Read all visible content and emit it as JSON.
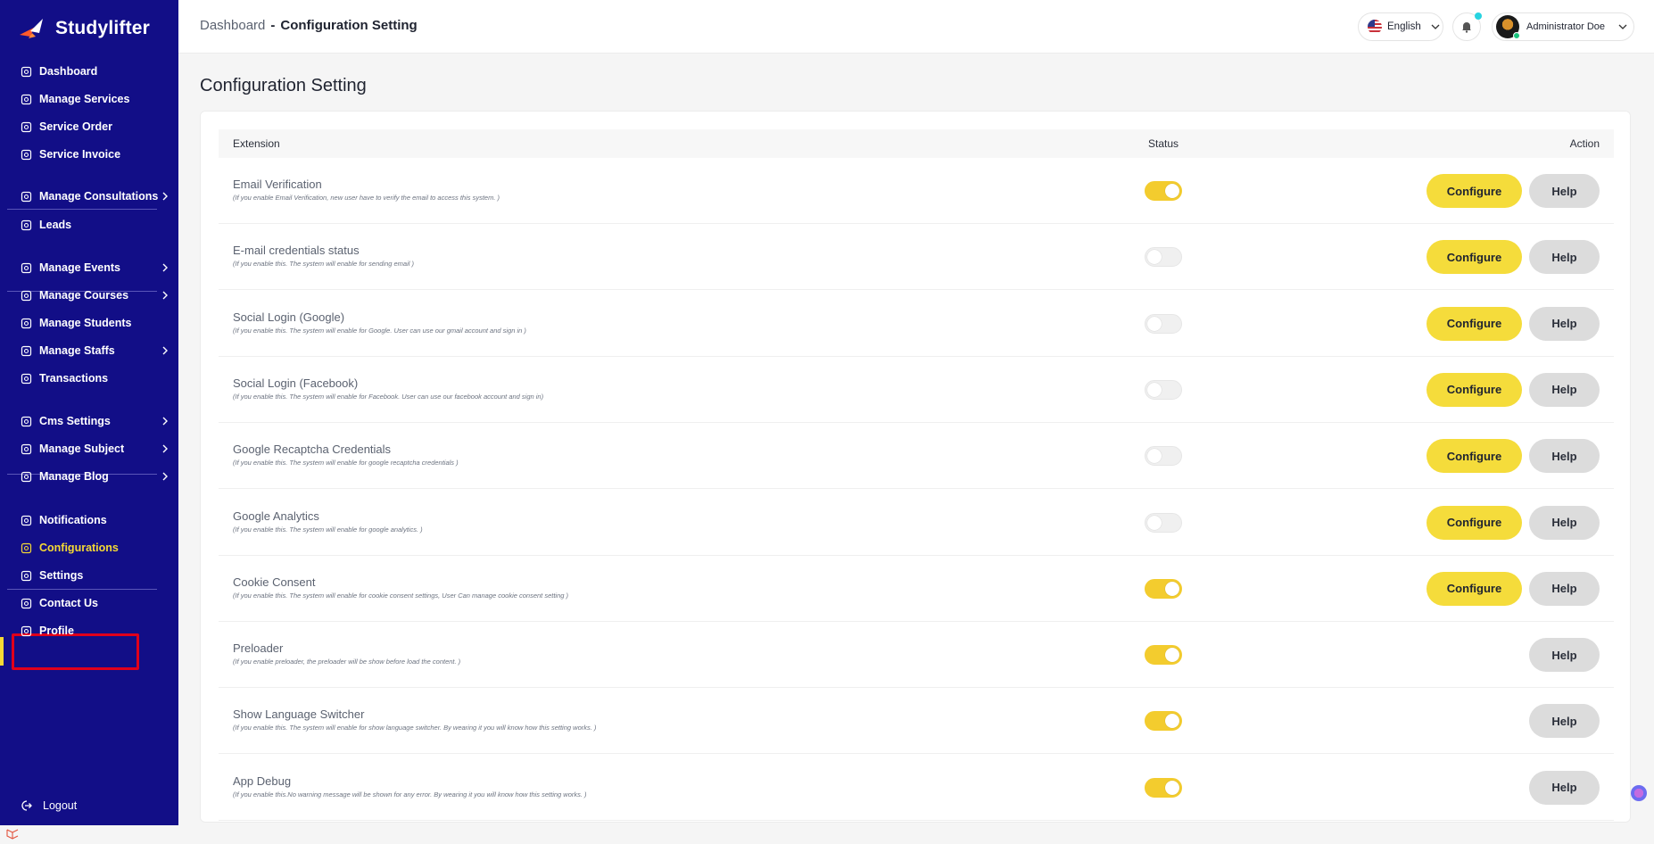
{
  "brand": {
    "name": "Studylifter"
  },
  "sidebar": {
    "items": [
      {
        "label": "Dashboard",
        "icon": "grid-icon"
      },
      {
        "label": "Manage Services",
        "icon": "services-icon"
      },
      {
        "label": "Service Order",
        "icon": "list-icon"
      },
      {
        "label": "Service Invoice",
        "icon": "invoice-icon"
      },
      {
        "label": "Manage Consultations",
        "icon": "consultation-icon",
        "expandable": true
      },
      {
        "label": "Leads",
        "icon": "dollar-icon"
      },
      {
        "label": "Manage Events",
        "icon": "calendar-icon",
        "expandable": true
      },
      {
        "label": "Manage Courses",
        "icon": "course-icon",
        "expandable": true
      },
      {
        "label": "Manage Students",
        "icon": "students-icon"
      },
      {
        "label": "Manage Staffs",
        "icon": "staff-icon",
        "expandable": true
      },
      {
        "label": "Transactions",
        "icon": "transaction-icon"
      },
      {
        "label": "Cms Settings",
        "icon": "gear-icon",
        "expandable": true
      },
      {
        "label": "Manage Subject",
        "icon": "book-icon",
        "expandable": true
      },
      {
        "label": "Manage Blog",
        "icon": "blog-icon",
        "expandable": true
      },
      {
        "label": "Notifications",
        "icon": "bell-icon"
      },
      {
        "label": "Configurations",
        "icon": "config-icon",
        "active": true
      },
      {
        "label": "Settings",
        "icon": "settings-icon"
      },
      {
        "label": "Contact Us",
        "icon": "contact-icon"
      },
      {
        "label": "Profile",
        "icon": "user-icon"
      }
    ],
    "logout": "Logout"
  },
  "header": {
    "breadcrumb_home": "Dashboard",
    "breadcrumb_sep": "-",
    "breadcrumb_current": "Configuration Setting",
    "language": "English",
    "user_name": "Administrator Doe"
  },
  "page": {
    "title": "Configuration Setting"
  },
  "table": {
    "headers": {
      "extension": "Extension",
      "status": "Status",
      "action": "Action"
    },
    "configure_label": "Configure",
    "help_label": "Help",
    "rows": [
      {
        "title": "Email Verification",
        "desc": "(If you enable Email Verification, new user have to verify the email to access this system. )",
        "enabled": true,
        "configurable": true
      },
      {
        "title": "E-mail credentials status",
        "desc": "(If you enable this. The system will enable for sending email )",
        "enabled": false,
        "configurable": true
      },
      {
        "title": "Social Login (Google)",
        "desc": "(If you enable this. The system will enable for Google. User can use our gmail account and sign in )",
        "enabled": false,
        "configurable": true
      },
      {
        "title": "Social Login (Facebook)",
        "desc": "(If you enable this. The system will enable for Facebook. User can use our facebook account and sign in)",
        "enabled": false,
        "configurable": true
      },
      {
        "title": "Google Recaptcha Credentials",
        "desc": "(If you enable this. The system will enable for google recaptcha credentials )",
        "enabled": false,
        "configurable": true
      },
      {
        "title": "Google Analytics",
        "desc": "(If you enable this. The system will enable for google analytics. )",
        "enabled": false,
        "configurable": true
      },
      {
        "title": "Cookie Consent",
        "desc": "(If you enable this. The system will enable for cookie consent settings, User Can manage cookie consent setting )",
        "enabled": true,
        "configurable": true
      },
      {
        "title": "Preloader",
        "desc": "(If you enable preloader, the preloader will be show before load the content. )",
        "enabled": true,
        "configurable": false
      },
      {
        "title": "Show Language Switcher",
        "desc": "(If you enable this. The system will enable for show language switcher. By wearing it you will know how this setting works. )",
        "enabled": true,
        "configurable": false
      },
      {
        "title": "App Debug",
        "desc": "(If you enable this.No warning message will be shown for any error. By wearing it you will know how this setting works. )",
        "enabled": true,
        "configurable": false
      }
    ]
  },
  "colors": {
    "sidebar_bg": "#120e87",
    "accent_yellow": "#f5dc3b",
    "active_outline": "#e0001b"
  }
}
